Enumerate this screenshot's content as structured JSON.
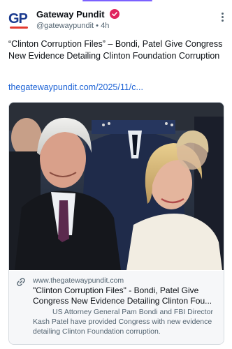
{
  "author": {
    "logo_text": "GP",
    "name": "Gateway Pundit",
    "handle": "@gatewaypundit",
    "time": "4h",
    "verified_color": "#e0245e"
  },
  "post": {
    "text": "“Clinton Corruption Files” – Bondi, Patel Give Congress New Evidence Detailing Clinton Foundation Corruption",
    "link": "thegatewaypundit.com/2025/11/c..."
  },
  "card": {
    "domain": "www.thegatewaypundit.com",
    "title": "\"Clinton Corruption Files\" - Bondi, Patel Give Congress New Evidence Detailing Clinton Fou...",
    "description": "US Attorney General Pam Bondi and FBI Director Kash Patel have provided Congress with new evidence detailing Clinton Foundation corruption.",
    "link_icon": "link-icon"
  },
  "colors": {
    "link": "#1d63d6",
    "accent": "#7b61ff"
  }
}
